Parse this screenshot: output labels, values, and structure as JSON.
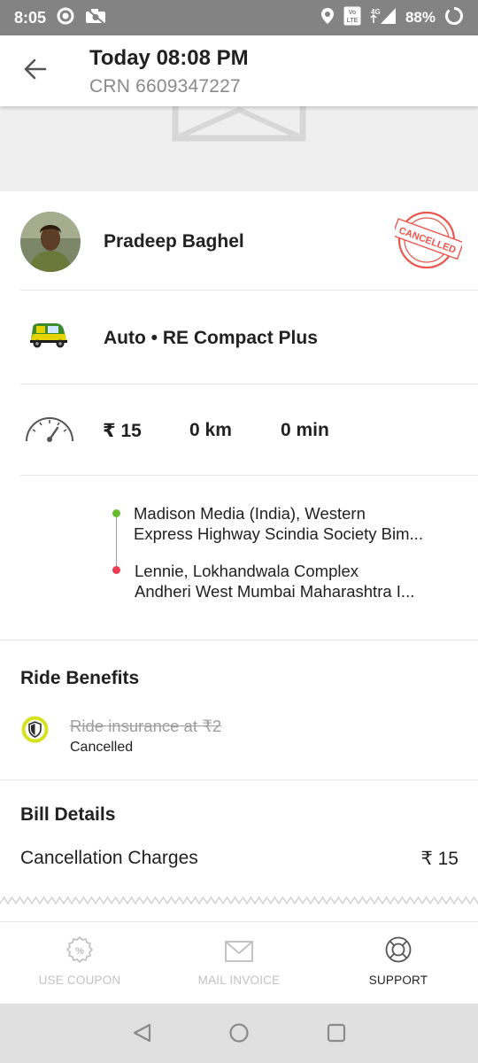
{
  "status_bar": {
    "time": "8:05",
    "network": "4G",
    "network_extra": "Vo LTE",
    "battery": "88%",
    "icons": [
      "record-icon",
      "camera-off-icon",
      "location-icon",
      "volte-icon",
      "signal-icon",
      "battery-icon"
    ]
  },
  "header": {
    "title": "Today 08:08 PM",
    "subtitle": "CRN 6609347227",
    "back_icon": "arrow-left-icon"
  },
  "driver": {
    "name": "Pradeep Baghel",
    "status_stamp": "CANCELLED"
  },
  "vehicle": {
    "label": "Auto • RE Compact Plus"
  },
  "stats": {
    "fare": "₹ 15",
    "distance": "0 km",
    "duration": "0 min"
  },
  "route": {
    "pickup_line1": "Madison Media (India), Western",
    "pickup_line2": "Express Highway Scindia Society Bim...",
    "drop_line1": "Lennie, Lokhandwala Complex",
    "drop_line2": "Andheri West Mumbai Maharashtra I..."
  },
  "benefits": {
    "title": "Ride Benefits",
    "item_label": "Ride insurance at ₹2",
    "item_status": "Cancelled"
  },
  "bill": {
    "title": "Bill Details",
    "line_label": "Cancellation Charges",
    "line_amount": "₹ 15"
  },
  "actions": {
    "coupon": "USE COUPON",
    "invoice": "MAIL INVOICE",
    "support": "SUPPORT"
  },
  "colors": {
    "status_bar": "#838383",
    "stamp_red": "#e8584f",
    "pickup_dot": "#66bb2e",
    "drop_dot": "#ec3d54",
    "shield_accent": "#d4e21f",
    "auto_yellow": "#e5d300",
    "auto_green": "#3d8b2b"
  }
}
